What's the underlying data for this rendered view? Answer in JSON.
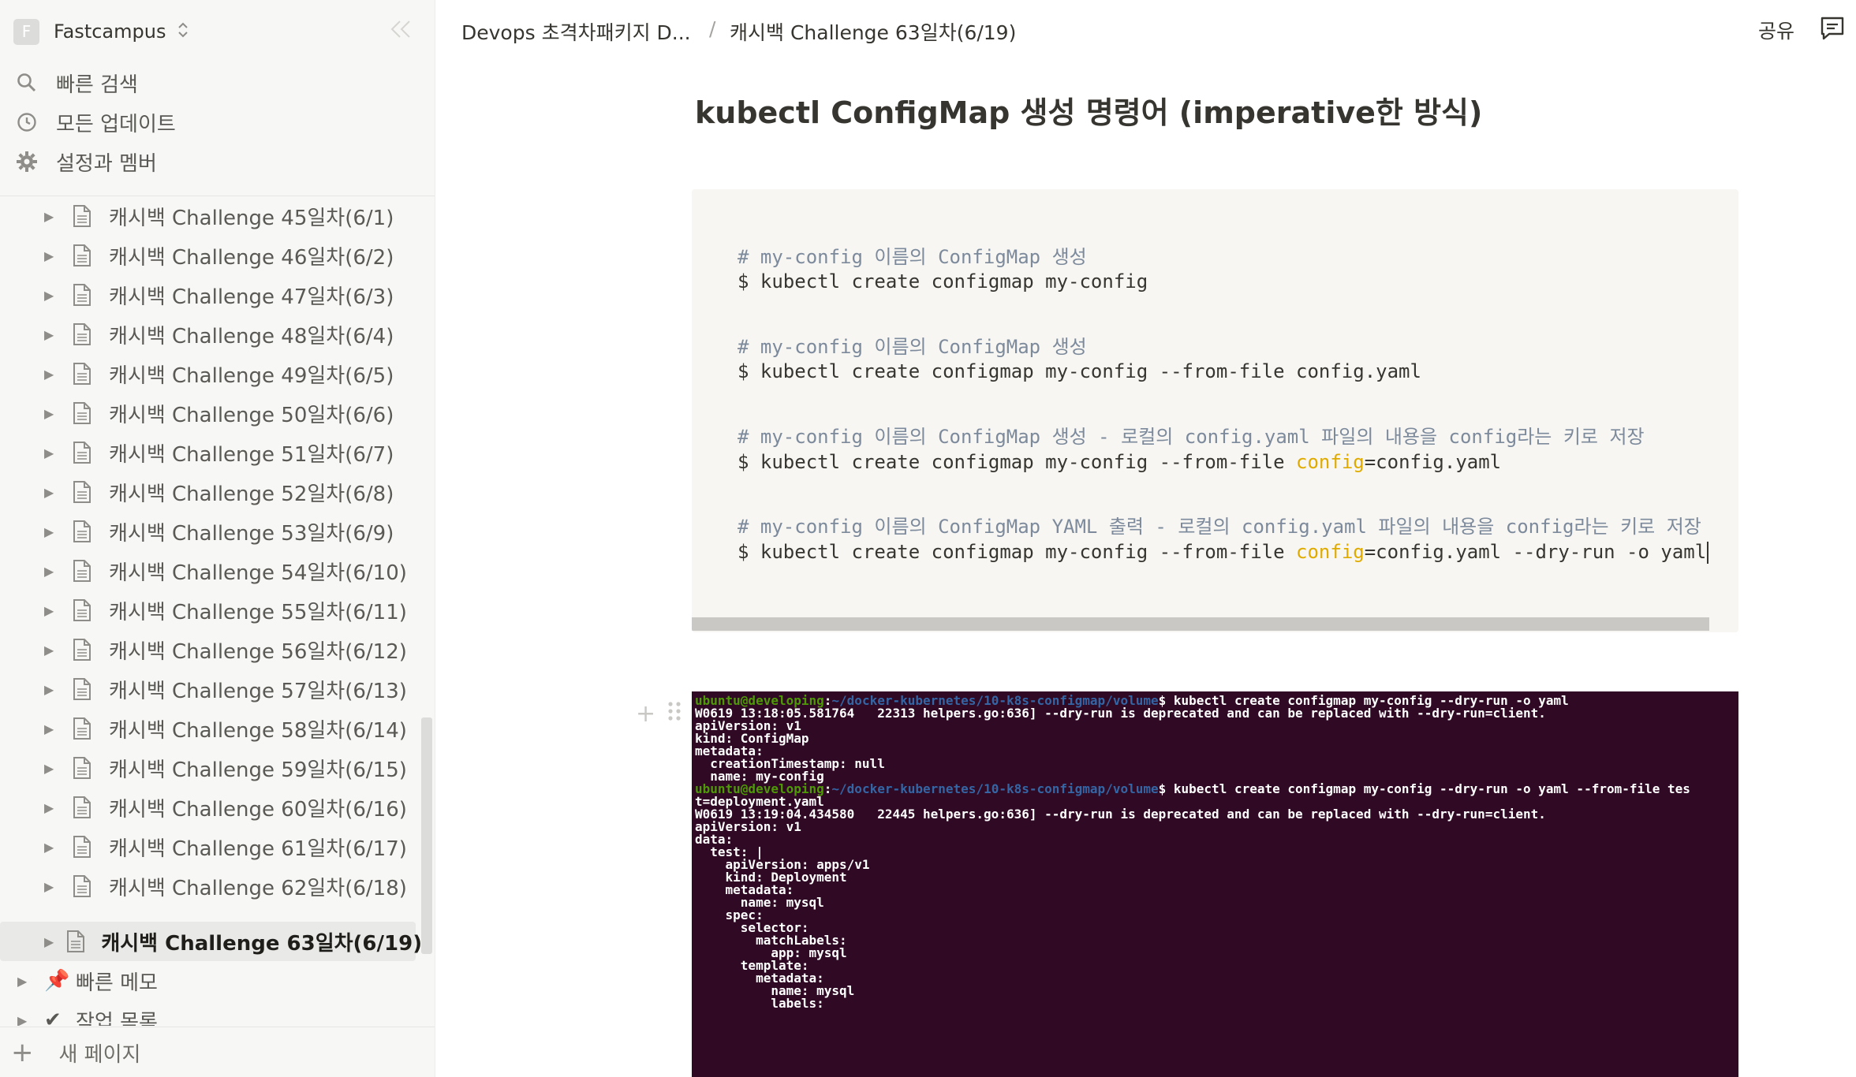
{
  "workspace": {
    "avatar": "F",
    "name": "Fastcampus"
  },
  "sidebar_menu": [
    {
      "label": "빠른 검색",
      "icon": "search-icon"
    },
    {
      "label": "모든 업데이트",
      "icon": "clock-icon"
    },
    {
      "label": "설정과 멤버",
      "icon": "gear-icon"
    }
  ],
  "pages": [
    "캐시백 Challenge 45일차(6/1)",
    "캐시백 Challenge 46일차(6/2)",
    "캐시백 Challenge 47일차(6/3)",
    "캐시백 Challenge 48일차(6/4)",
    "캐시백 Challenge 49일차(6/5)",
    "캐시백 Challenge 50일차(6/6)",
    "캐시백 Challenge 51일차(6/7)",
    "캐시백 Challenge 52일차(6/8)",
    "캐시백 Challenge 53일차(6/9)",
    "캐시백 Challenge 54일차(6/10)",
    "캐시백 Challenge 55일차(6/11)",
    "캐시백 Challenge 56일차(6/12)",
    "캐시백 Challenge 57일차(6/13)",
    "캐시백 Challenge 58일차(6/14)",
    "캐시백 Challenge 59일차(6/15)",
    "캐시백 Challenge 60일차(6/16)",
    "캐시백 Challenge 61일차(6/17)",
    "캐시백 Challenge 62일차(6/18)",
    "캐시백 Challenge 63일차(6/19)"
  ],
  "root_pages": [
    {
      "label": "빠른 메모",
      "icon": "pushpin-icon"
    },
    {
      "label": "작업 목록",
      "icon": "checkmark-icon"
    }
  ],
  "new_page": "새 페이지",
  "breadcrumb": {
    "parent": "Devops 초격차패키지 D...",
    "separator": "/",
    "current": "캐시백 Challenge 63일차(6/19)"
  },
  "topbar": {
    "share": "공유"
  },
  "heading": "kubectl ConfigMap 생성 명령어 (imperative한 방식)",
  "code": {
    "c1": "# my-config 이름의 ConfigMap 생성",
    "l1": "$ kubectl create configmap my-config",
    "c2": "# my-config 이름의 ConfigMap 생성",
    "l2": "$ kubectl create configmap my-config --from-file config.yaml",
    "c3": "# my-config 이름의 ConfigMap 생성 - 로컬의 config.yaml 파일의 내용을 config라는 키로 저장",
    "l3_pre": "$ kubectl create configmap my-config --from-file ",
    "l3_kw": "config",
    "l3_post": "=config.yaml",
    "c4": "# my-config 이름의 ConfigMap YAML 출력 - 로컬의 config.yaml 파일의 내용을 config라는 키로 저장",
    "l4_pre": "$ kubectl create configmap my-config --from-file ",
    "l4_kw": "config",
    "l4_post": "=config.yaml --dry-run -o yaml"
  },
  "terminal": {
    "user": "ubuntu@developing",
    "colon": ":",
    "path": "~/docker-kubernetes/10-k8s-configmap/volume",
    "cmd1": "$ kubectl create configmap my-config --dry-run -o yaml",
    "cmd2": "$ kubectl create configmap my-config --dry-run -o yaml --from-file tes",
    "lines_a": [
      "W0619 13:18:05.581764   22313 helpers.go:636] --dry-run is deprecated and can be replaced with --dry-run=client.",
      "apiVersion: v1",
      "kind: ConfigMap",
      "metadata:",
      "  creationTimestamp: null",
      "  name: my-config"
    ],
    "lines_b": [
      "t=deployment.yaml",
      "W0619 13:19:04.434580   22445 helpers.go:636] --dry-run is deprecated and can be replaced with --dry-run=client.",
      "apiVersion: v1",
      "data:",
      "  test: |",
      "    apiVersion: apps/v1",
      "    kind: Deployment",
      "    metadata:",
      "      name: mysql",
      "    spec:",
      "      selector:",
      "        matchLabels:",
      "          app: mysql",
      "      template:",
      "        metadata:",
      "          name: mysql",
      "          labels:"
    ]
  }
}
